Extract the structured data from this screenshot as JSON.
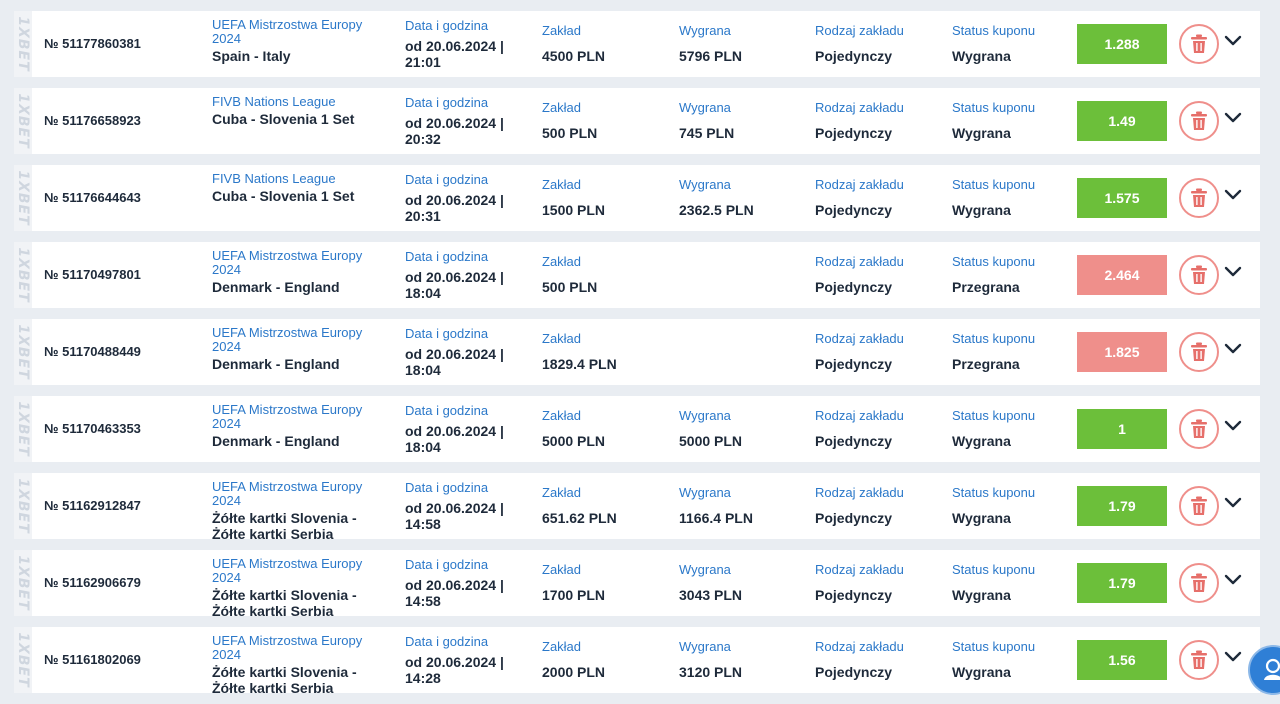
{
  "logo_text": "1XBET",
  "labels": {
    "datetime": "Data i godzina",
    "stake": "Zakład",
    "win": "Wygrana",
    "bet_type": "Rodzaj zakładu",
    "status": "Status kuponu"
  },
  "colors": {
    "win": "#6cbf3a",
    "lost": "#ef8f8b",
    "tournament_text": "#2b78c9"
  },
  "icons": {
    "delete": "trash-icon",
    "expand": "chevron-down-icon",
    "support": "chat-support-icon"
  },
  "bets": [
    {
      "number": "№ 51177860381",
      "tournament": "UEFA Mistrzostwa Europy 2024",
      "match": "Spain - Italy",
      "datetime": "od 20.06.2024 | 21:01",
      "stake": "4500 PLN",
      "win": "5796 PLN",
      "bet_type": "Pojedynczy",
      "status": "Wygrana",
      "coefficient": "1.288",
      "result": "win"
    },
    {
      "number": "№ 51176658923",
      "tournament": "FIVB Nations League",
      "match": "Cuba - Slovenia 1 Set",
      "datetime": "od 20.06.2024 | 20:32",
      "stake": "500 PLN",
      "win": "745 PLN",
      "bet_type": "Pojedynczy",
      "status": "Wygrana",
      "coefficient": "1.49",
      "result": "win"
    },
    {
      "number": "№ 51176644643",
      "tournament": "FIVB Nations League",
      "match": "Cuba - Slovenia 1 Set",
      "datetime": "od 20.06.2024 | 20:31",
      "stake": "1500 PLN",
      "win": "2362.5 PLN",
      "bet_type": "Pojedynczy",
      "status": "Wygrana",
      "coefficient": "1.575",
      "result": "win"
    },
    {
      "number": "№ 51170497801",
      "tournament": "UEFA Mistrzostwa Europy 2024",
      "match": "Denmark - England",
      "datetime": "od 20.06.2024 | 18:04",
      "stake": "500 PLN",
      "win": null,
      "bet_type": "Pojedynczy",
      "status": "Przegrana",
      "coefficient": "2.464",
      "result": "lost"
    },
    {
      "number": "№ 51170488449",
      "tournament": "UEFA Mistrzostwa Europy 2024",
      "match": "Denmark - England",
      "datetime": "od 20.06.2024 | 18:04",
      "stake": "1829.4 PLN",
      "win": null,
      "bet_type": "Pojedynczy",
      "status": "Przegrana",
      "coefficient": "1.825",
      "result": "lost"
    },
    {
      "number": "№ 51170463353",
      "tournament": "UEFA Mistrzostwa Europy 2024",
      "match": "Denmark - England",
      "datetime": "od 20.06.2024 | 18:04",
      "stake": "5000 PLN",
      "win": "5000 PLN",
      "bet_type": "Pojedynczy",
      "status": "Wygrana",
      "coefficient": "1",
      "result": "win"
    },
    {
      "number": "№ 51162912847",
      "tournament": "UEFA Mistrzostwa Europy 2024",
      "match": "Żółte kartki Slovenia - Żółte kartki Serbia",
      "datetime": "od 20.06.2024 | 14:58",
      "stake": "651.62 PLN",
      "win": "1166.4 PLN",
      "bet_type": "Pojedynczy",
      "status": "Wygrana",
      "coefficient": "1.79",
      "result": "win"
    },
    {
      "number": "№ 51162906679",
      "tournament": "UEFA Mistrzostwa Europy 2024",
      "match": "Żółte kartki Slovenia - Żółte kartki Serbia",
      "datetime": "od 20.06.2024 | 14:58",
      "stake": "1700 PLN",
      "win": "3043 PLN",
      "bet_type": "Pojedynczy",
      "status": "Wygrana",
      "coefficient": "1.79",
      "result": "win"
    },
    {
      "number": "№ 51161802069",
      "tournament": "UEFA Mistrzostwa Europy 2024",
      "match": "Żółte kartki Slovenia - Żółte kartki Serbia",
      "datetime": "od 20.06.2024 | 14:28",
      "stake": "2000 PLN",
      "win": "3120 PLN",
      "bet_type": "Pojedynczy",
      "status": "Wygrana",
      "coefficient": "1.56",
      "result": "win"
    }
  ]
}
